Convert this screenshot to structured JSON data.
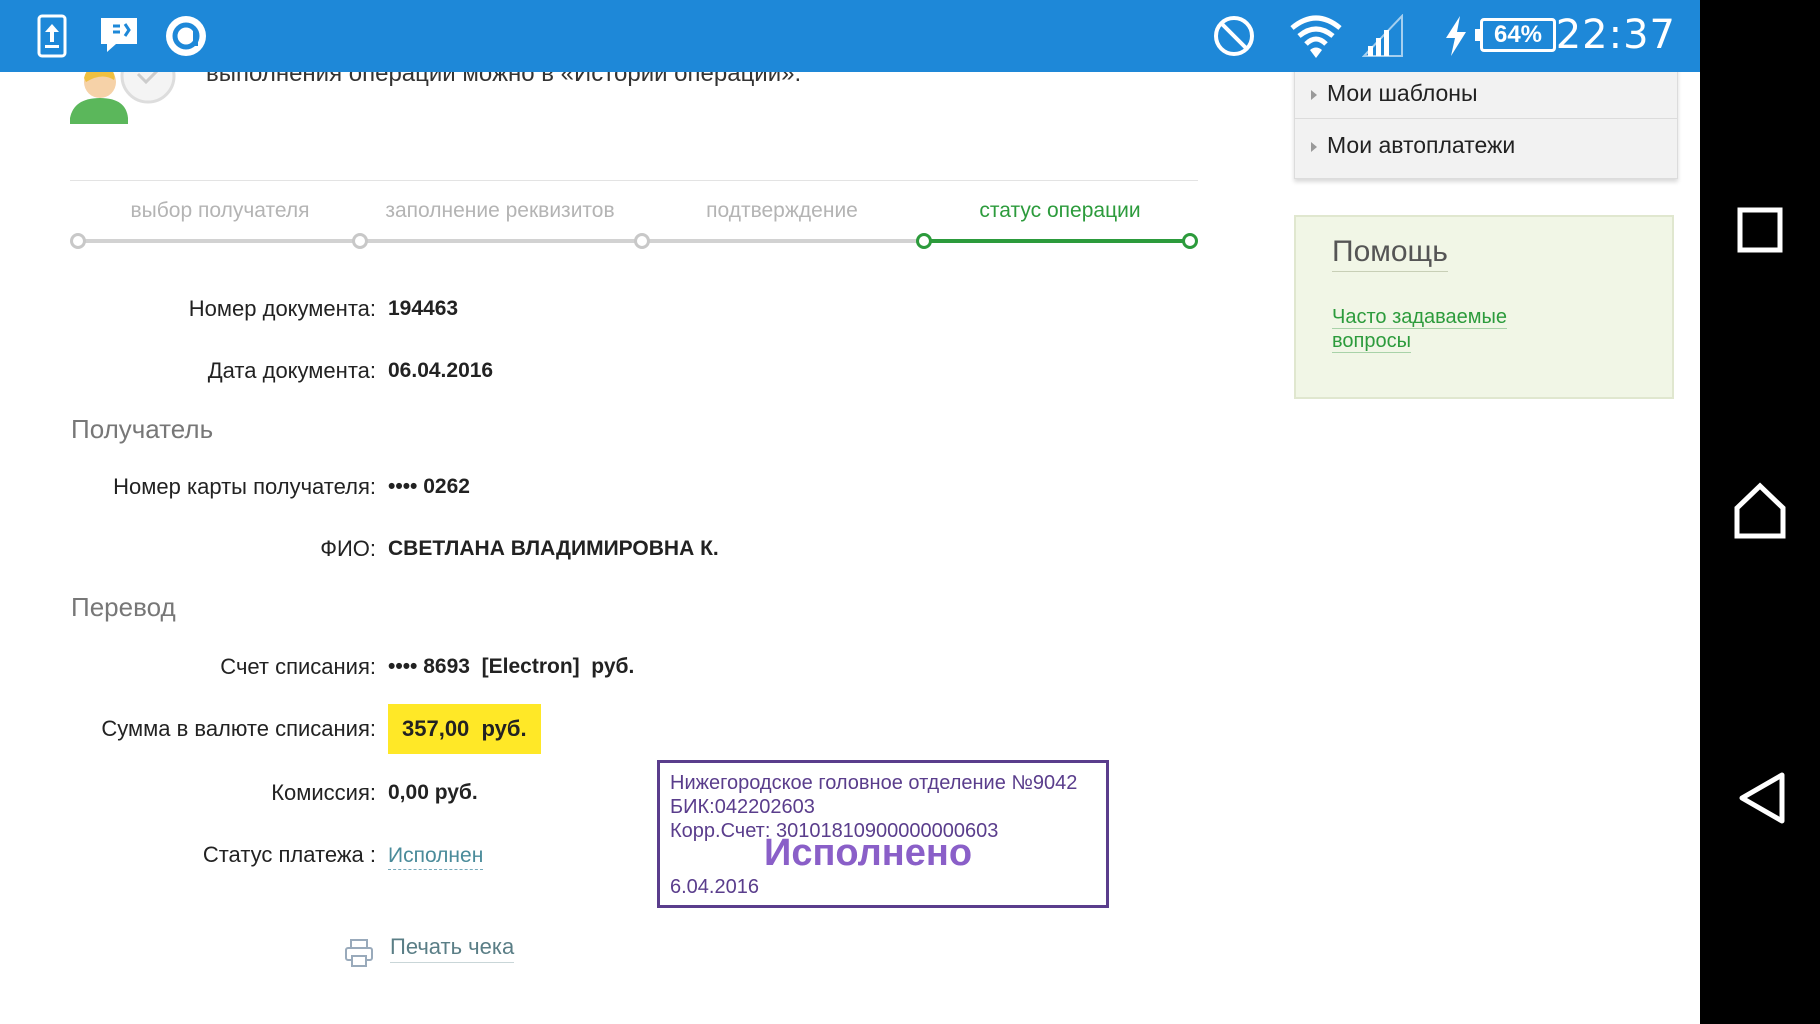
{
  "status_bar": {
    "battery": "64%",
    "time": "22:37",
    "icons": [
      "upload-icon",
      "chat-icon",
      "app-circle-icon",
      "do-not-disturb-icon",
      "wifi-icon",
      "signal-icon",
      "charging-icon",
      "battery-icon"
    ]
  },
  "intro": {
    "text": "выполнения операции можно в «Истории операций»."
  },
  "steps": [
    {
      "label": "выбор получателя",
      "active": false
    },
    {
      "label": "заполнение реквизитов",
      "active": false
    },
    {
      "label": "подтверждение",
      "active": false
    },
    {
      "label": "статус операции",
      "active": true
    }
  ],
  "document": {
    "number_label": "Номер документа:",
    "number": "194463",
    "date_label": "Дата документа:",
    "date": "06.04.2016"
  },
  "recipient": {
    "title": "Получатель",
    "card_label": "Номер карты получателя:",
    "card": "•••• 0262",
    "name_label": "ФИО:",
    "name": "СВЕТЛАНА ВЛАДИМИРОВНА К."
  },
  "transfer": {
    "title": "Перевод",
    "account_label": "Счет списания:",
    "account": "•••• 8693  [Electron]  руб.",
    "amount_label": "Сумма в валюте списания:",
    "amount": "357,00  руб.",
    "fee_label": "Комиссия:",
    "fee": "0,00 руб.",
    "status_label": "Статус платежа :",
    "status": "Исполнен"
  },
  "print": {
    "label": "Печать чека"
  },
  "stamp": {
    "line1": "Нижегородское головное отделение №9042",
    "line2": "БИК:042202603",
    "line3": "Корр.Счет: 30101810900000000603",
    "big": "Исполнено",
    "date": "6.04.2016"
  },
  "sidebar": {
    "menu": [
      "Мои шаблоны",
      "Мои автоплатежи"
    ],
    "help_title": "Помощь",
    "help_link": "Часто задаваемые вопросы"
  },
  "colors": {
    "status_bar": "#1e88d8",
    "accent_green": "#2c9b3c",
    "highlight": "#ffe827",
    "stamp": "#5a3d8c"
  }
}
